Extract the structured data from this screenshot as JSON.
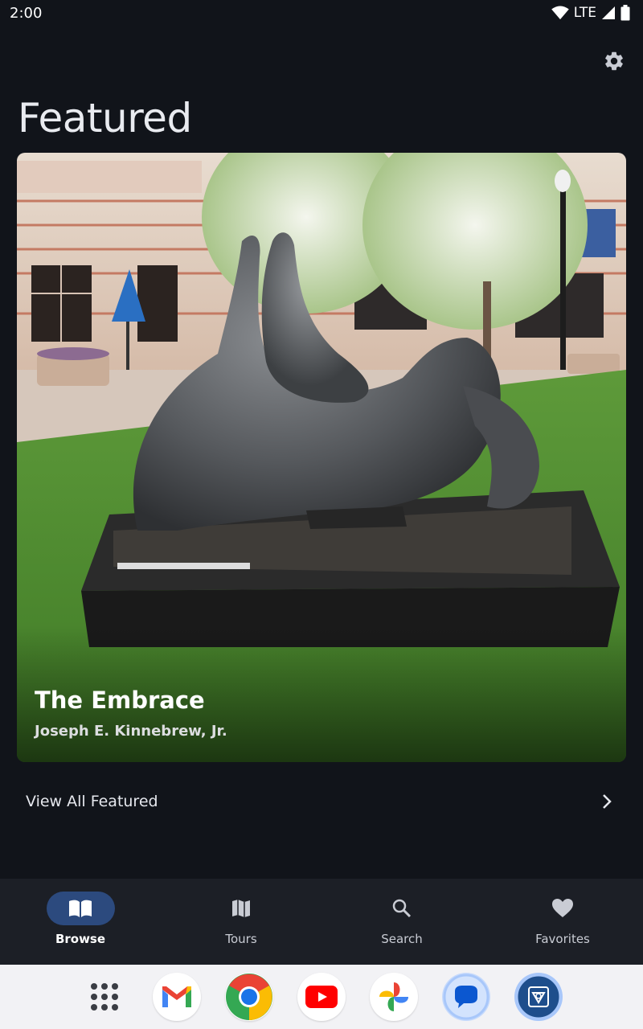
{
  "status_bar": {
    "time": "2:00",
    "network": "LTE"
  },
  "page": {
    "title": "Featured"
  },
  "featured": {
    "title": "The Embrace",
    "artist": "Joseph E. Kinnebrew, Jr."
  },
  "view_all": {
    "label": "View All Featured"
  },
  "nav": {
    "items": [
      {
        "label": "Browse",
        "icon": "book-icon",
        "active": true
      },
      {
        "label": "Tours",
        "icon": "map-icon",
        "active": false
      },
      {
        "label": "Search",
        "icon": "search-icon",
        "active": false
      },
      {
        "label": "Favorites",
        "icon": "heart-icon",
        "active": false
      }
    ]
  },
  "dock": {
    "apps": [
      "app-drawer",
      "gmail",
      "chrome",
      "youtube",
      "photos",
      "messages",
      "art-app"
    ]
  },
  "colors": {
    "background": "#11141a",
    "nav_active": "#2c4a7e",
    "nav_bar": "#1c1f26"
  }
}
